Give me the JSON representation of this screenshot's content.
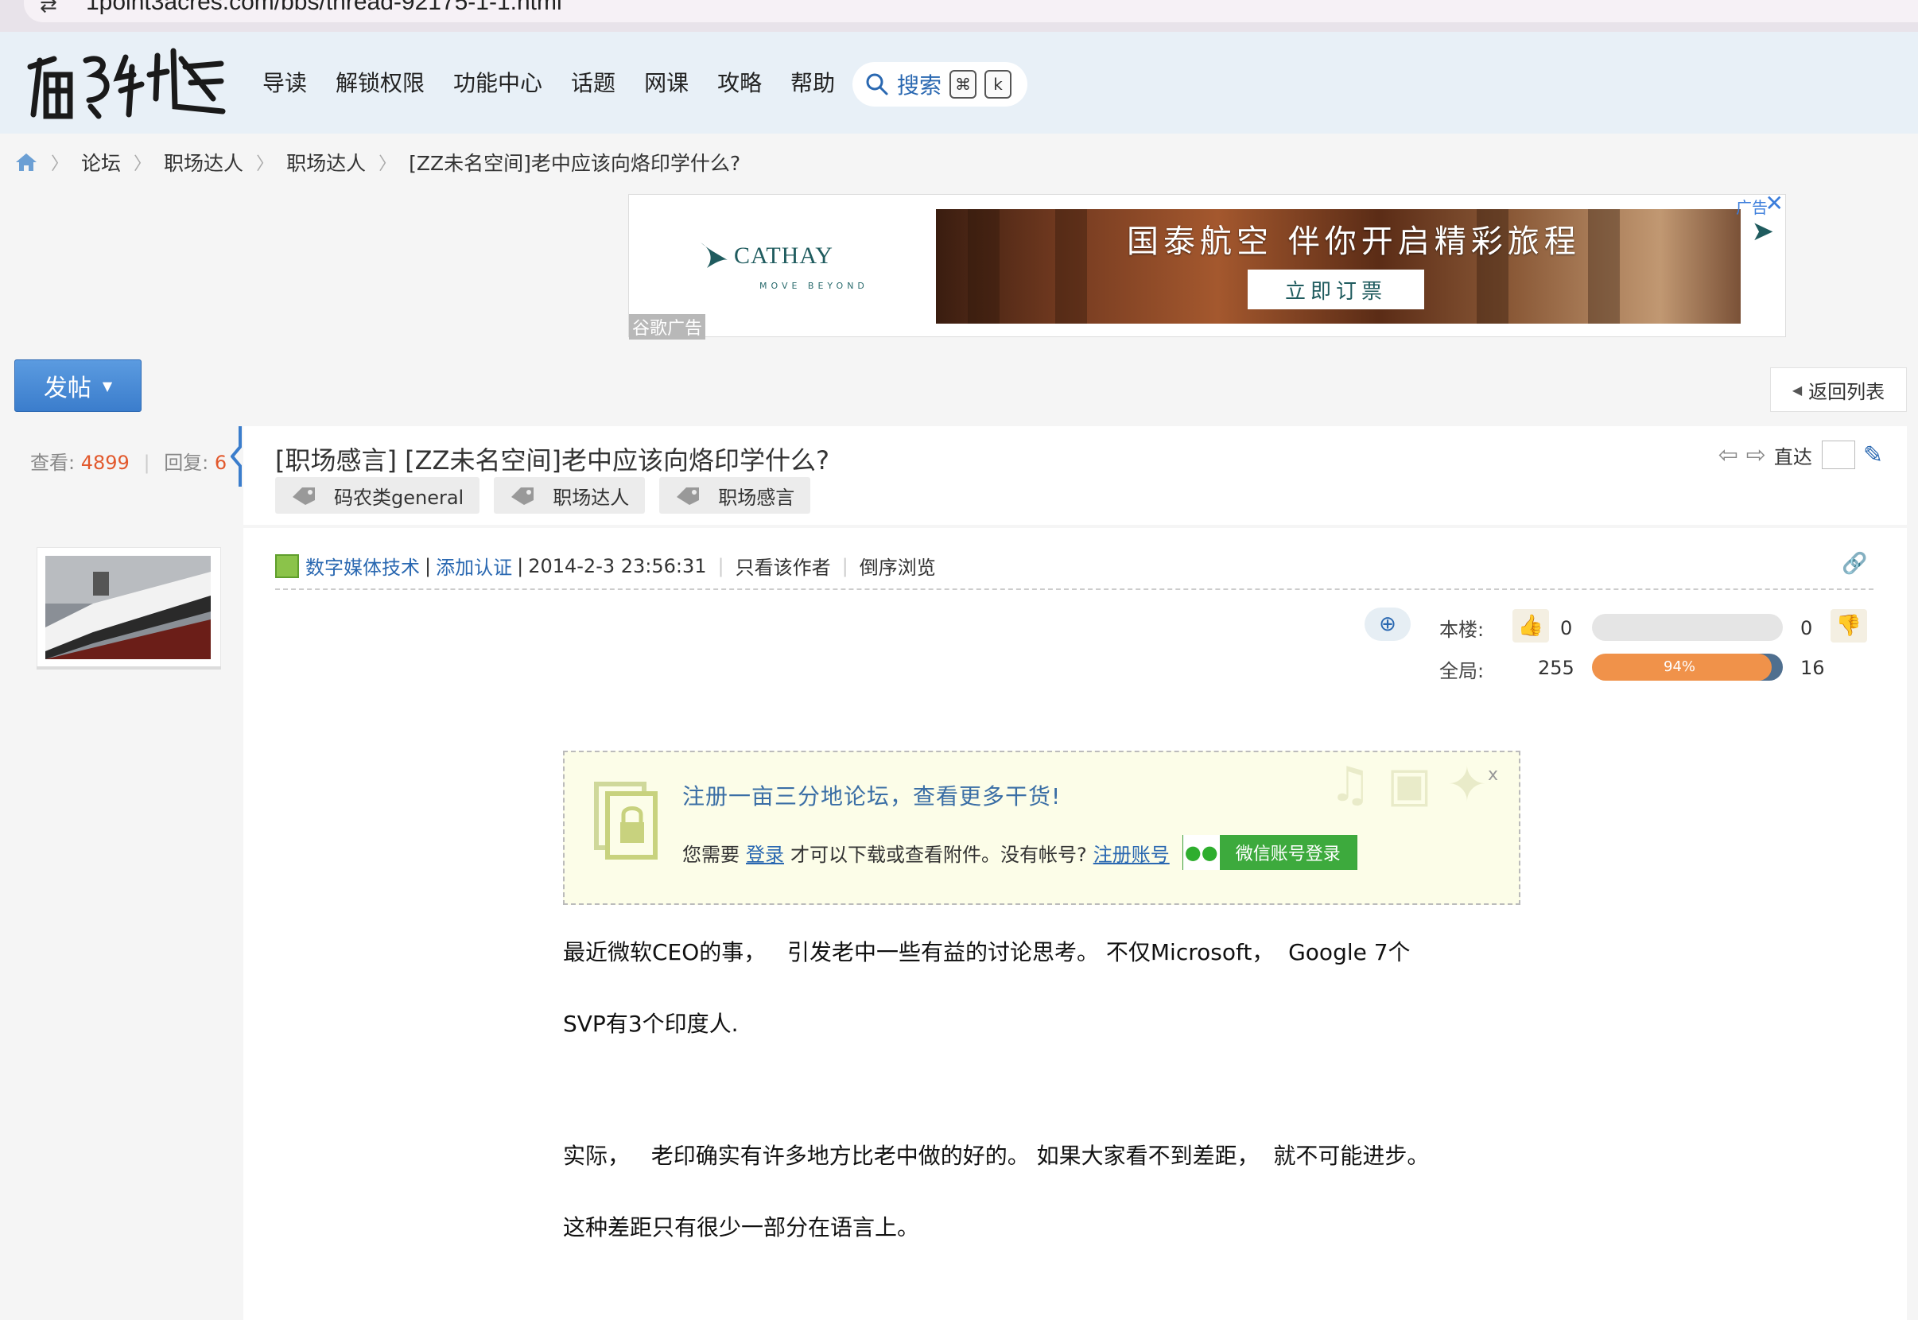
{
  "browser": {
    "url_text": "1point3acres.com/bbs/thread-92175-1-1.html"
  },
  "nav": {
    "logo_alt": "一亩三分地",
    "items": [
      "导读",
      "解锁权限",
      "功能中心",
      "话题",
      "网课",
      "攻略",
      "帮助"
    ],
    "search_label": "搜索",
    "search_keys": [
      "⌘",
      "k"
    ]
  },
  "breadcrumb": [
    "论坛",
    "职场达人",
    "职场达人",
    "[ZZ未名空间]老中应该向烙印学什么?"
  ],
  "ad": {
    "brand": "CATHAY",
    "brand_sub": "MOVE BEYOND",
    "badge": "谷歌广告",
    "headline": "国泰航空 伴你开启精彩旅程",
    "cta": "立即订票",
    "tag": "广告"
  },
  "post_button": "发帖",
  "back_button": "返回列表",
  "stats": {
    "views_label": "查看:",
    "views": "4899",
    "replies_label": "回复:",
    "replies": "6"
  },
  "thread": {
    "title": "[职场感言] [ZZ未名空间]老中应该向烙印学什么?",
    "tags": [
      "码农类general",
      "职场达人",
      "职场感言"
    ],
    "jump_label": "直达"
  },
  "post": {
    "author": "数字媒体技术",
    "verify": "添加认证",
    "datetime": "2014-2-3 23:56:31",
    "only_author": "只看该作者",
    "reverse": "倒序浏览",
    "vote": {
      "floor_label": "本楼:",
      "floor_up": "0",
      "floor_down": "0",
      "global_label": "全局:",
      "global_up": "255",
      "global_down": "16",
      "global_percent_label": "94%",
      "global_fraction": 0.94
    },
    "notice": {
      "title": "注册一亩三分地论坛，查看更多干货!",
      "pre": "您需要",
      "login": "登录",
      "mid": "才可以下载或查看附件。没有帐号?",
      "register": "注册账号",
      "wechat": "微信账号登录",
      "close": "x"
    },
    "paragraphs": [
      "最近微软CEO的事，   引发老中一些有益的讨论思考。 不仅Microsoft，  Google 7个",
      "SVP有3个印度人.",
      "实际，   老印确实有许多地方比老中做的好的。 如果大家看不到差距，  就不可能进步。",
      "这种差距只有很少一部分在语言上。"
    ]
  }
}
